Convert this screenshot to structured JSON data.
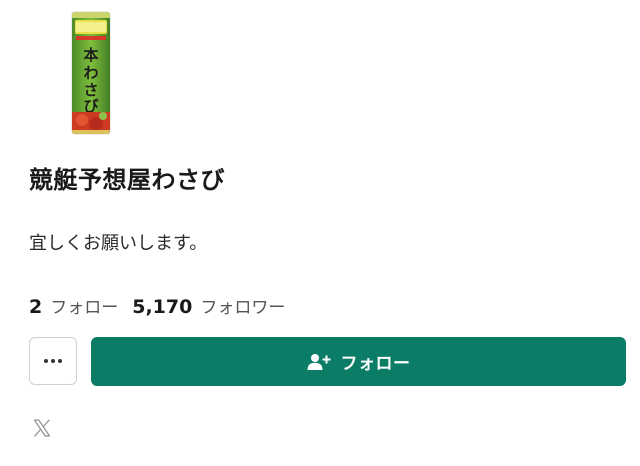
{
  "colors": {
    "accent": "#0b7d67",
    "text": "#1a1a1a",
    "muted": "#555555",
    "border": "#d0d0d0"
  },
  "profile": {
    "avatar_icon": "wasabi-tube-avatar",
    "avatar_text": "本わさび",
    "display_name": "競艇予想屋わさび",
    "bio": "宜しくお願いします。"
  },
  "stats": {
    "following_count": "2",
    "following_label": "フォロー",
    "followers_count": "5,170",
    "followers_label": "フォロワー"
  },
  "actions": {
    "more_icon": "more-horizontal-icon",
    "follow_icon": "person-add-icon",
    "follow_label": "フォロー"
  },
  "social": {
    "x_icon": "x-logo-icon"
  }
}
